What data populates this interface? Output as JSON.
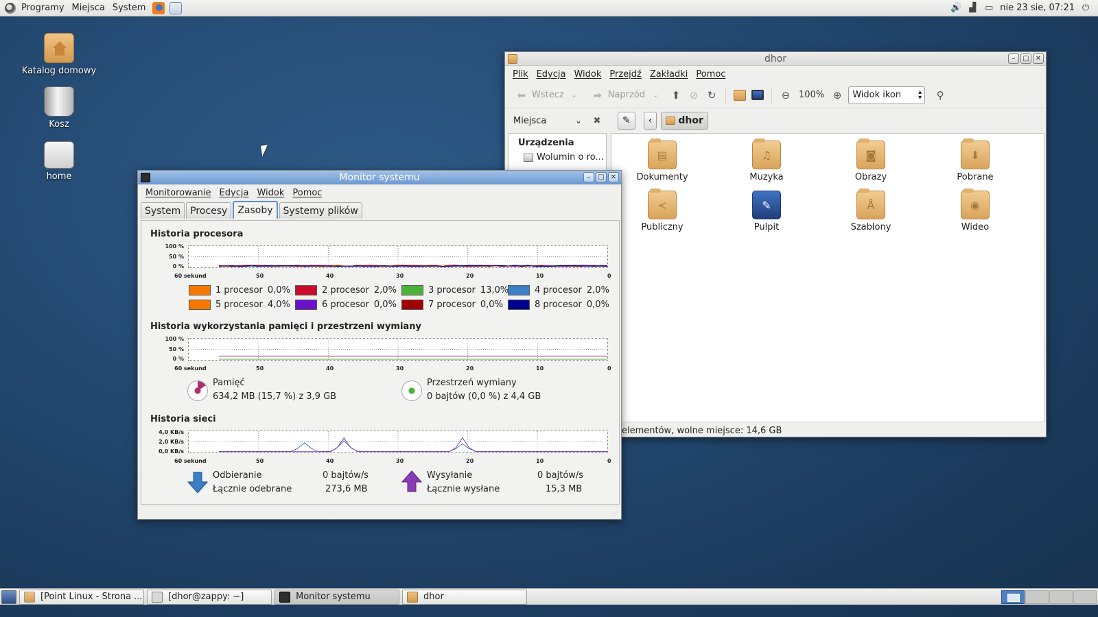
{
  "top_panel": {
    "menus": [
      "Programy",
      "Miejsca",
      "System"
    ],
    "clock": "nie 23 sie, 07:21"
  },
  "desktop_icons": [
    {
      "label": "Katalog domowy",
      "icon": "home-folder-icon"
    },
    {
      "label": "Kosz",
      "icon": "trash-icon"
    },
    {
      "label": "home",
      "icon": "drive-icon"
    }
  ],
  "file_manager": {
    "title": "dhor",
    "menu": [
      "Plik",
      "Edycja",
      "Widok",
      "Przejdź",
      "Zakładki",
      "Pomoc"
    ],
    "toolbar": {
      "back": "Wstecz",
      "forward": "Naprzód",
      "zoom": "100%",
      "view_mode": "Widok ikon"
    },
    "places_label": "Miejsca",
    "path_current": "dhor",
    "sidebar": {
      "header": "Urządzenia",
      "items": [
        "Wolumin o ro..."
      ]
    },
    "folders": [
      "Dokumenty",
      "Muzyka",
      "Obrazy",
      "Pobrane",
      "Publiczny",
      "Pulpit",
      "Szablony",
      "Wideo"
    ],
    "status": "elementów, wolne miejsce: 14,6 GB"
  },
  "system_monitor": {
    "title": "Monitor systemu",
    "menu": [
      "Monitorowanie",
      "Edycja",
      "Widok",
      "Pomoc"
    ],
    "tabs": [
      "System",
      "Procesy",
      "Zasoby",
      "Systemy plików"
    ],
    "active_tab": "Zasoby",
    "cpu": {
      "title": "Historia procesora",
      "y_ticks": [
        "100 %",
        "50 %",
        "0 %"
      ],
      "x_ticks": [
        "60 sekund",
        "50",
        "40",
        "30",
        "20",
        "10",
        "0"
      ],
      "cores": [
        {
          "label": "1 procesor",
          "value": "0,0%",
          "color": "#f57900"
        },
        {
          "label": "2 procesor",
          "value": "2,0%",
          "color": "#cc0a2e"
        },
        {
          "label": "3 procesor",
          "value": "13,0%",
          "color": "#4ab23a"
        },
        {
          "label": "4 procesor",
          "value": "2,0%",
          "color": "#3c7fc4"
        },
        {
          "label": "5 procesor",
          "value": "4,0%",
          "color": "#f57900"
        },
        {
          "label": "6 procesor",
          "value": "0,0%",
          "color": "#6c10cc"
        },
        {
          "label": "7 procesor",
          "value": "0,0%",
          "color": "#a00000"
        },
        {
          "label": "8 procesor",
          "value": "0,0%",
          "color": "#000090"
        }
      ]
    },
    "memory": {
      "title": "Historia wykorzystania pamięci i przestrzeni wymiany",
      "y_ticks": [
        "100 %",
        "50 %",
        "0 %"
      ],
      "x_ticks": [
        "60 sekund",
        "50",
        "40",
        "30",
        "20",
        "10",
        "0"
      ],
      "ram_label": "Pamięć",
      "ram_value": "634,2 MB (15,7 %) z 3,9 GB",
      "ram_fraction": 0.157,
      "ram_color": "#b0306a",
      "swap_label": "Przestrzeń wymiany",
      "swap_value": "0 bajtów (0,0 %) z 4,4 GB",
      "swap_fraction": 0.0,
      "swap_color": "#4ab23a"
    },
    "network": {
      "title": "Historia sieci",
      "y_ticks": [
        "4,0 KB/s",
        "2,0 KB/s",
        "0,0 KB/s"
      ],
      "x_ticks": [
        "60 sekund",
        "50",
        "40",
        "30",
        "20",
        "10",
        "0"
      ],
      "recv_label": "Odbieranie",
      "recv_rate": "0 bajtów/s",
      "recv_total_label": "Łącznie odebrane",
      "recv_total": "273,6 MB",
      "send_label": "Wysyłanie",
      "send_rate": "0 bajtów/s",
      "send_total_label": "Łącznie wysłane",
      "send_total": "15,3 MB",
      "recv_color": "#3c7fc4",
      "send_color": "#8a3cb4"
    }
  },
  "taskbar": {
    "tasks": [
      {
        "label": "[Point Linux - Strona ...",
        "icon": "browser-icon"
      },
      {
        "label": "[dhor@zappy: ~]",
        "icon": "terminal-icon"
      },
      {
        "label": "Monitor systemu",
        "icon": "monitor-icon",
        "active": true
      },
      {
        "label": "dhor",
        "icon": "folder-icon"
      }
    ]
  }
}
